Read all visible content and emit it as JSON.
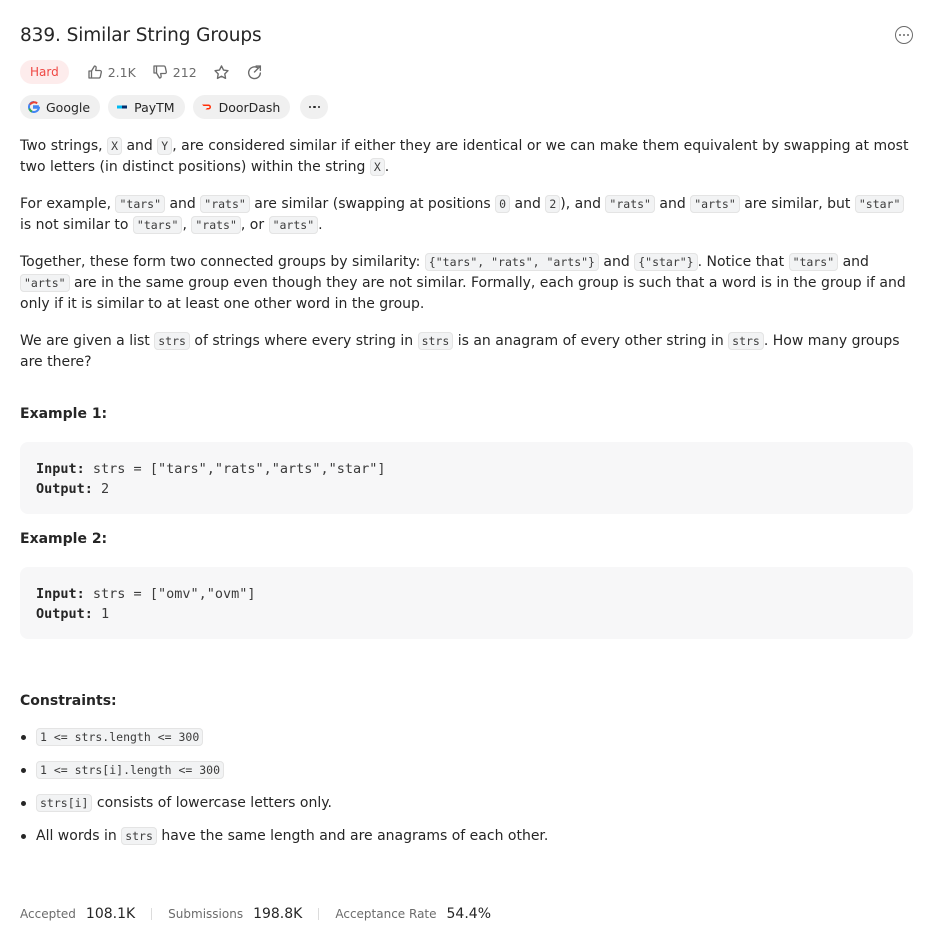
{
  "problem": {
    "title": "839. Similar String Groups",
    "difficulty": "Hard",
    "likes": "2.1K",
    "dislikes": "212"
  },
  "companies": [
    {
      "name": "Google",
      "icon": "google-logo-icon"
    },
    {
      "name": "PayTM",
      "icon": "paytm-logo-icon"
    },
    {
      "name": "DoorDash",
      "icon": "doordash-logo-icon"
    }
  ],
  "description": {
    "p1": [
      "Two strings, ",
      "X",
      " and ",
      "Y",
      ", are considered similar if either they are identical or we can make them equivalent by swapping at most two letters (in distinct positions) within the string ",
      "X",
      "."
    ],
    "p2": [
      "For example, ",
      "\"tars\"",
      " and ",
      "\"rats\"",
      " are similar (swapping at positions ",
      "0",
      " and ",
      "2",
      "), and ",
      "\"rats\"",
      " and ",
      "\"arts\"",
      " are similar, but ",
      "\"star\"",
      " is not similar to ",
      "\"tars\"",
      ", ",
      "\"rats\"",
      ", or ",
      "\"arts\"",
      "."
    ],
    "p3": [
      "Together, these form two connected groups by similarity: ",
      "{\"tars\", \"rats\", \"arts\"}",
      " and ",
      "{\"star\"}",
      ".  Notice that ",
      "\"tars\"",
      " and ",
      "\"arts\"",
      " are in the same group even though they are not similar.  Formally, each group is such that a word is in the group if and only if it is similar to at least one other word in the group."
    ],
    "p4": [
      "We are given a list ",
      "strs",
      " of strings where every string in ",
      "strs",
      " is an anagram of every other string in ",
      "strs",
      ". How many groups are there?"
    ]
  },
  "examples": [
    {
      "title": "Example 1:",
      "input_label": "Input:",
      "input": "strs = [\"tars\",\"rats\",\"arts\",\"star\"]",
      "output_label": "Output:",
      "output": "2"
    },
    {
      "title": "Example 2:",
      "input_label": "Input:",
      "input": "strs = [\"omv\",\"ovm\"]",
      "output_label": "Output:",
      "output": "1"
    }
  ],
  "constraints_title": "Constraints:",
  "constraints": [
    {
      "code": "1 <= strs.length <= 300",
      "text": ""
    },
    {
      "code": "1 <= strs[i].length <= 300",
      "text": ""
    },
    {
      "code": "strs[i]",
      "text": " consists of lowercase letters only."
    },
    {
      "pre": "All words in ",
      "code": "strs",
      "text": " have the same length and are anagrams of each other."
    }
  ],
  "stats": {
    "accepted_label": "Accepted",
    "accepted": "108.1K",
    "submissions_label": "Submissions",
    "submissions": "198.8K",
    "rate_label": "Acceptance Rate",
    "rate": "54.4%"
  },
  "colors": {
    "hard": "#ef4743",
    "hard_bg": "#fdecec",
    "text": "#262626",
    "muted": "#6b6b6b"
  }
}
